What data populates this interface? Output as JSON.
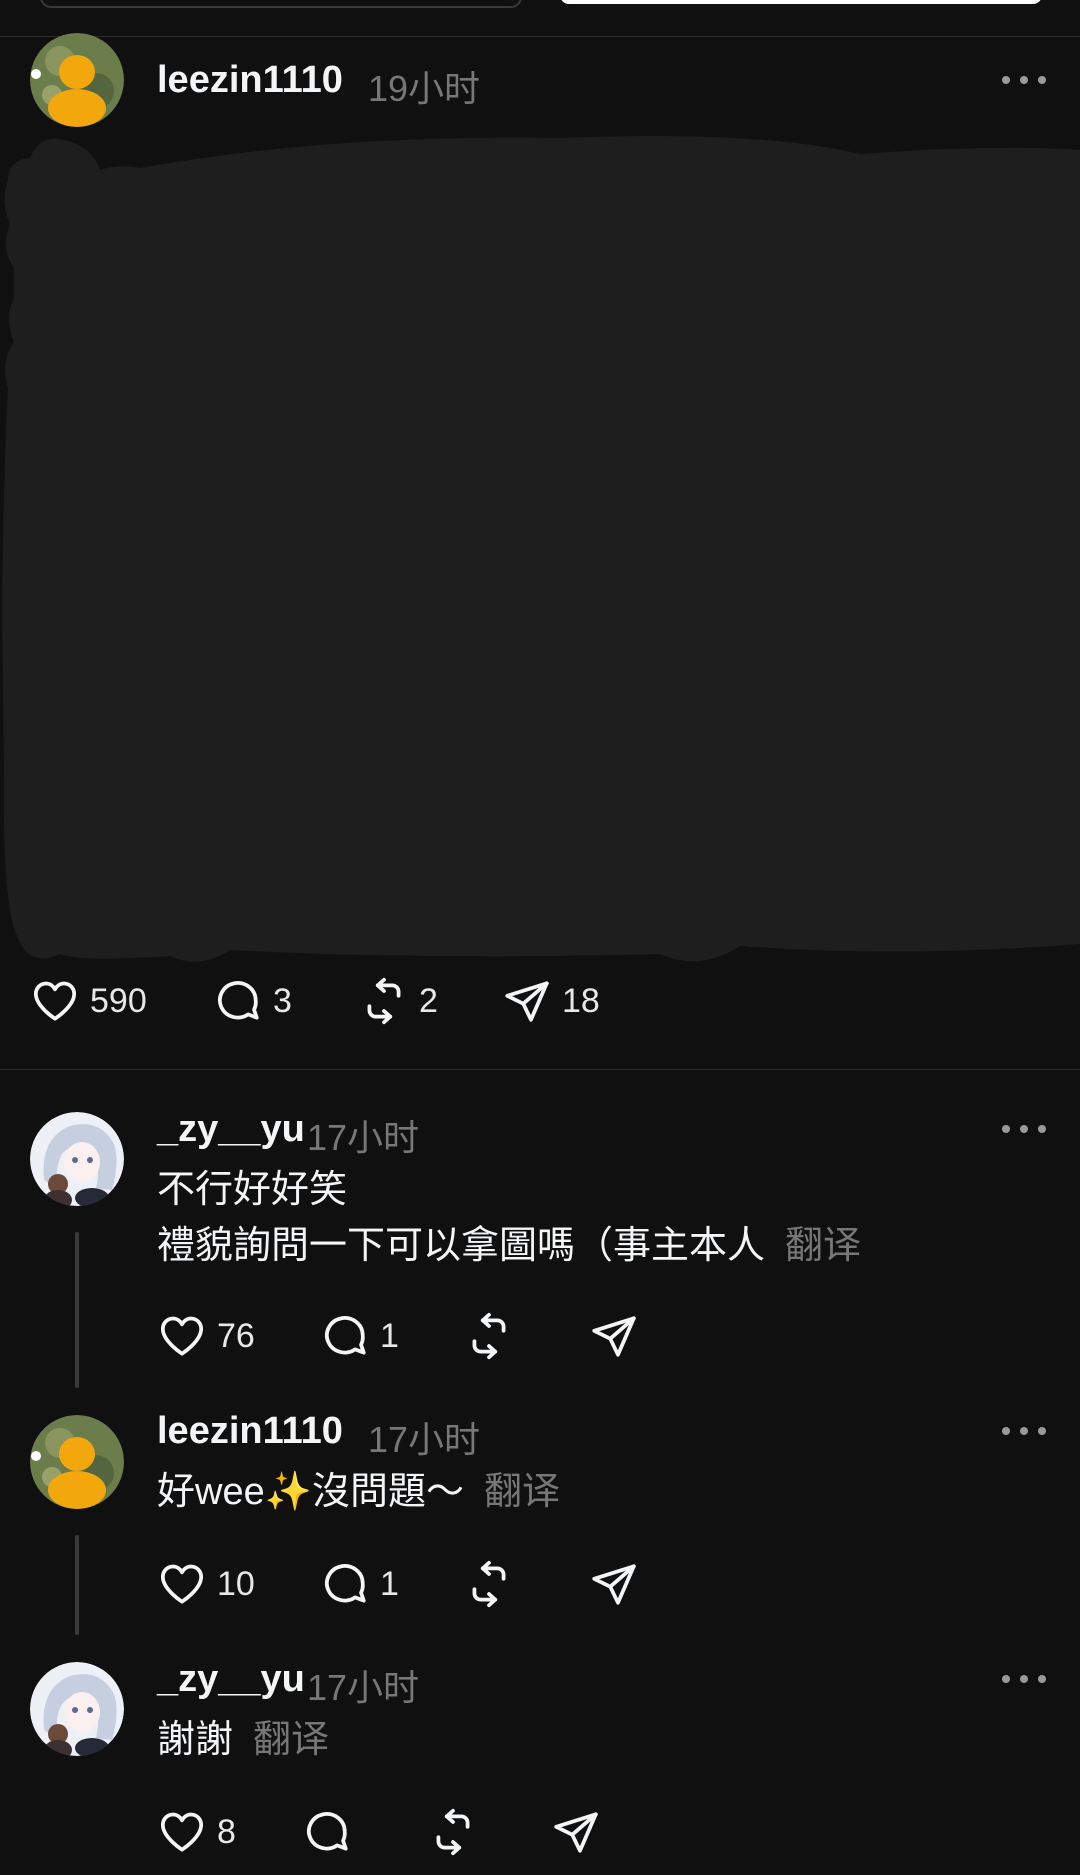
{
  "post": {
    "username": "leezin1110",
    "time": "19小时",
    "actions": {
      "likes": "590",
      "comments": "3",
      "reposts": "2",
      "shares": "18"
    }
  },
  "replies": [
    {
      "username": "_zy__yu",
      "time": "17小时",
      "lines": [
        "不行好好笑",
        "禮貌詢問一下可以拿圖嗎（事主本人"
      ],
      "translate": "翻译",
      "actions": {
        "likes": "76",
        "comments": "1"
      }
    },
    {
      "username": "leezin1110",
      "time": "17小时",
      "lines": [
        "好wee✨沒問題～"
      ],
      "translate": "翻译",
      "actions": {
        "likes": "10",
        "comments": "1"
      }
    },
    {
      "username": "_zy__yu",
      "time": "17小时",
      "lines": [
        "謝謝"
      ],
      "translate": "翻译",
      "actions": {
        "likes": "8"
      }
    }
  ],
  "icons": {
    "like": "heart-icon",
    "comment": "comment-icon",
    "repost": "repost-icon",
    "share": "send-icon",
    "more": "more-options-icon"
  },
  "colors": {
    "background": "#101010",
    "text_primary": "#f3f5f7",
    "text_secondary": "#777777",
    "redaction": "#1e1e1e"
  }
}
